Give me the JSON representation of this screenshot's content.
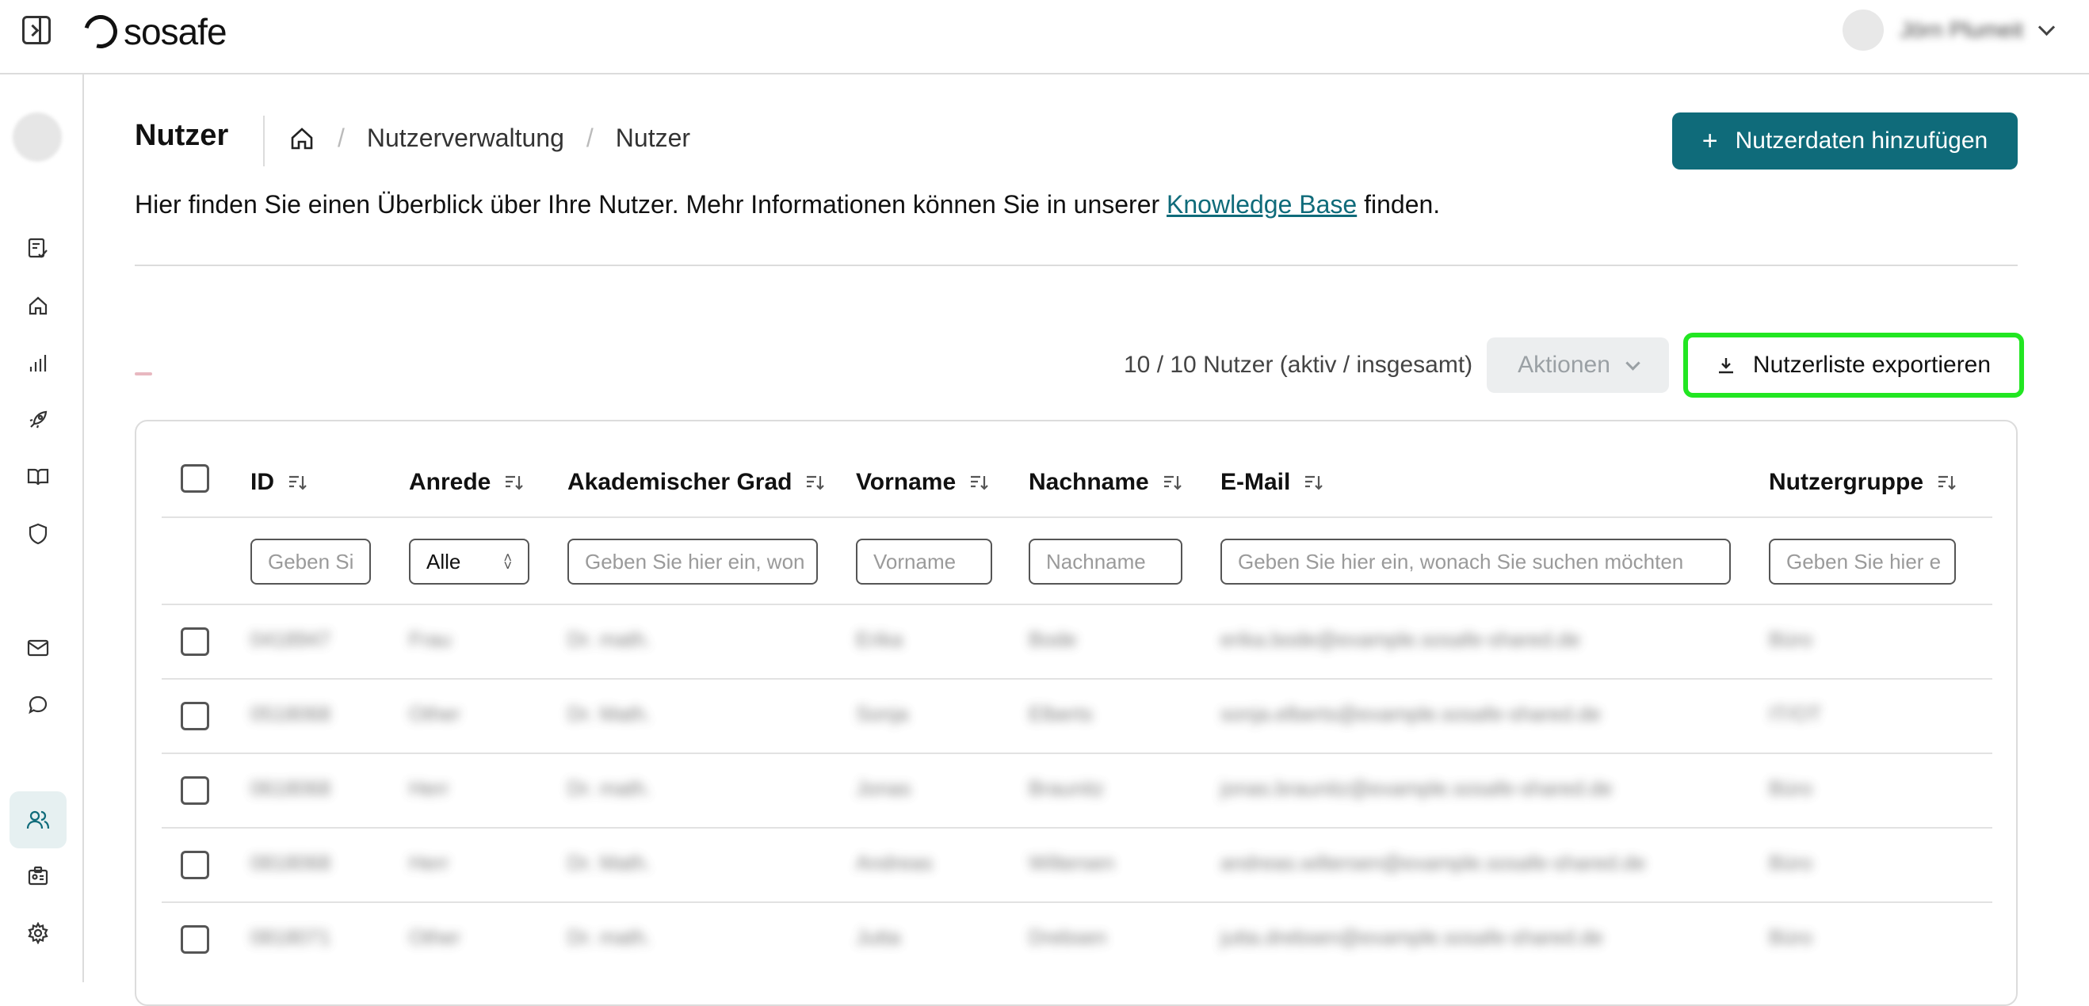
{
  "app": {
    "logo_text": "sosafe",
    "user_name": "Jörn Plumeit"
  },
  "page": {
    "title": "Nutzer",
    "breadcrumb": [
      "Nutzerverwaltung",
      "Nutzer"
    ],
    "add_button": "Nutzerdaten hinzufügen",
    "desc_before": "Hier finden Sie einen Überblick über Ihre Nutzer. Mehr Informationen können Sie in unserer ",
    "desc_link": "Knowledge Base",
    "desc_after": " finden."
  },
  "toolbar": {
    "count": "10 / 10 Nutzer (aktiv / insgesamt)",
    "actions": "Aktionen",
    "export": "Nutzerliste exportieren"
  },
  "table": {
    "columns": [
      "ID",
      "Anrede",
      "Akademischer Grad",
      "Vorname",
      "Nachname",
      "E-Mail",
      "Nutzergruppe"
    ],
    "filters": {
      "id": "Geben Si",
      "anrede": "Alle",
      "grad": "Geben Sie hier ein, won",
      "vorname": "Vorname",
      "nachname": "Nachname",
      "email": "Geben Sie hier ein, wonach Sie suchen möchten",
      "gruppe": "Geben Sie hier e"
    },
    "rows": [
      [
        "0418947",
        "Frau",
        "Dr. math.",
        "Erika",
        "Bode",
        "erika.bode@example.sosafe-shared.de",
        "Büro"
      ],
      [
        "0518068",
        "Other",
        "Dr. Math.",
        "Sonja",
        "Elberts",
        "sonja.elberts@example.sosafe-shared.de",
        "IT/OT"
      ],
      [
        "0618068",
        "Herr",
        "Dr. math.",
        "Jonas",
        "Braunitz",
        "jonas.braunitz@example.sosafe-shared.de",
        "Büro"
      ],
      [
        "0818068",
        "Herr",
        "Dr. Math.",
        "Andreas",
        "Wiltersen",
        "andreas.wiltersen@example.sosafe-shared.de",
        "Büro"
      ],
      [
        "0818071",
        "Other",
        "Dr. math.",
        "Jutta",
        "Drebsen",
        "jutta.drebsen@example.sosafe-shared.de",
        "Büro"
      ]
    ]
  },
  "colors": {
    "accent": "#0f6b7a",
    "highlight": "#22e622"
  }
}
